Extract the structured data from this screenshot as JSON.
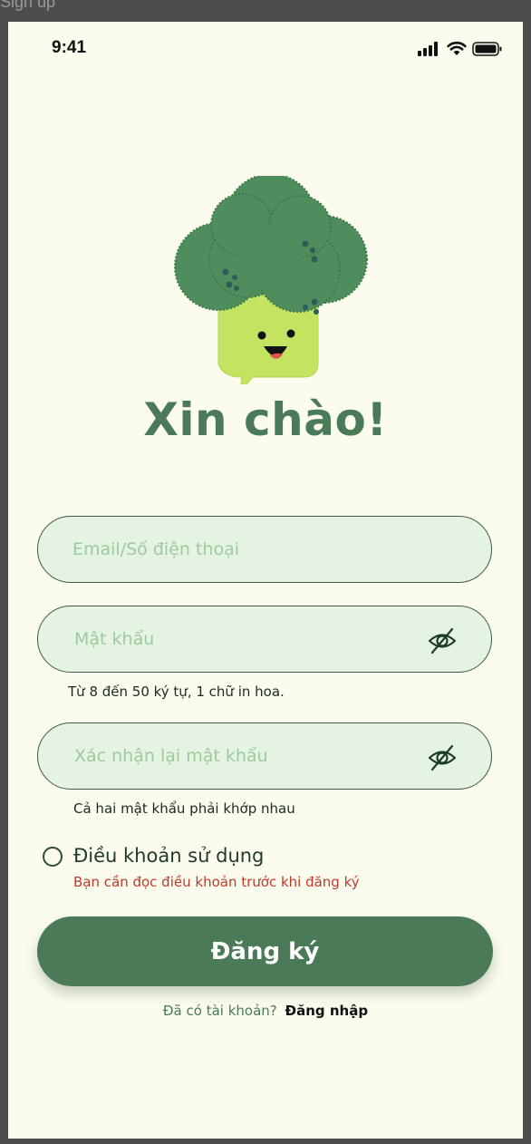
{
  "frame": {
    "title": "Sign up"
  },
  "status_bar": {
    "time": "9:41",
    "icons": [
      "signal-icon",
      "wifi-icon",
      "battery-icon"
    ]
  },
  "mascot": {
    "icon": "broccoli-mascot-icon"
  },
  "greeting": "Xin chào!",
  "form": {
    "email": {
      "placeholder": "Email/Số điện thoại",
      "value": ""
    },
    "password": {
      "placeholder": "Mật khẩu",
      "value": "",
      "hint": "Từ 8 đến 50 ký tự, 1 chữ in hoa.",
      "toggle_icon": "eye-off-icon"
    },
    "confirm": {
      "placeholder": "Xác nhận lại mật khẩu",
      "value": "",
      "hint": "Cả hai mật khẩu phải khớp nhau",
      "toggle_icon": "eye-off-icon"
    },
    "terms": {
      "label": "Điều khoản sử dụng",
      "checked": false,
      "error": "Bạn cần đọc điều khoản trước khi đăng ký"
    },
    "submit_label": "Đăng ký"
  },
  "login": {
    "prompt": "Đã có tài khoản?",
    "link": "Đăng nhập"
  },
  "colors": {
    "primary": "#4a7a58",
    "background": "#fbfcee",
    "field_fill": "#e4f3e2",
    "placeholder": "#9fc99e",
    "error": "#c0392b"
  }
}
